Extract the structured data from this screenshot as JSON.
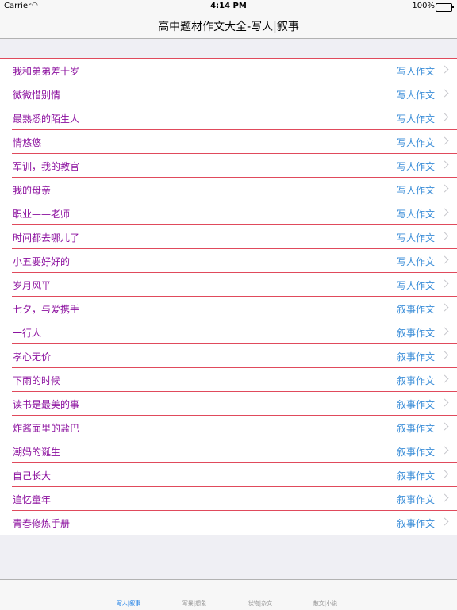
{
  "status": {
    "carrier": "Carrier",
    "time": "4:14 PM",
    "battery": "100%"
  },
  "nav": {
    "title": "高中题材作文大全-写人|叙事"
  },
  "items": [
    {
      "title": "我和弟弟差十岁",
      "category": "写人作文"
    },
    {
      "title": "微微惜别情",
      "category": "写人作文"
    },
    {
      "title": "最熟悉的陌生人",
      "category": "写人作文"
    },
    {
      "title": "情悠悠",
      "category": "写人作文"
    },
    {
      "title": "军训，我的教官",
      "category": "写人作文"
    },
    {
      "title": "我的母亲",
      "category": "写人作文"
    },
    {
      "title": "职业——老师",
      "category": "写人作文"
    },
    {
      "title": "时间都去哪儿了",
      "category": "写人作文"
    },
    {
      "title": "小五要好好的",
      "category": "写人作文"
    },
    {
      "title": "岁月风平",
      "category": "写人作文"
    },
    {
      "title": "七夕，与爱携手",
      "category": "叙事作文"
    },
    {
      "title": "一行人",
      "category": "叙事作文"
    },
    {
      "title": "孝心无价",
      "category": "叙事作文"
    },
    {
      "title": "下雨的时候",
      "category": "叙事作文"
    },
    {
      "title": "读书是最美的事",
      "category": "叙事作文"
    },
    {
      "title": "炸酱面里的盐巴",
      "category": "叙事作文"
    },
    {
      "title": "潮妈的诞生",
      "category": "叙事作文"
    },
    {
      "title": "自己长大",
      "category": "叙事作文"
    },
    {
      "title": "追忆童年",
      "category": "叙事作文"
    },
    {
      "title": "青春修炼手册",
      "category": "叙事作文"
    }
  ],
  "tabs": [
    {
      "label": "写人|叙事",
      "active": true
    },
    {
      "label": "写景|想象",
      "active": false
    },
    {
      "label": "状物|杂文",
      "active": false
    },
    {
      "label": "散文|小说",
      "active": false
    }
  ],
  "colors": {
    "title": "#8b0f9e",
    "category": "#3b8ed8",
    "separator": "#e04a5c",
    "tab_active": "#1a7ee6"
  }
}
